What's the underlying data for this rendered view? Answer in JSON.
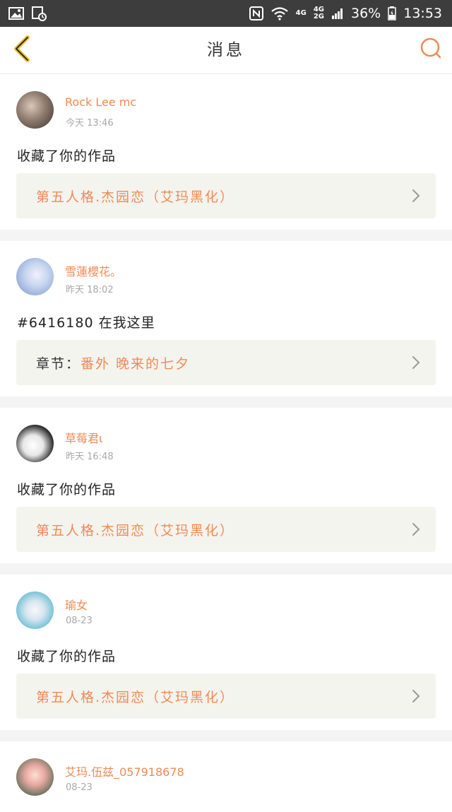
{
  "status_bar": {
    "network": "4G",
    "network2": "4G",
    "network3": "2G",
    "battery": "36%",
    "time": "13:53"
  },
  "header": {
    "title": "消息",
    "back_icon": "chevron-left-icon",
    "search_icon": "search-icon",
    "accent_color": "#f08a55"
  },
  "messages": [
    {
      "username": "Rock Lee mc",
      "time": "今天 13:46",
      "action": "收藏了你的作品",
      "work_prefix": "",
      "work": "第五人格.杰园恋（艾玛黑化）"
    },
    {
      "username": "雪蓮櫻花。",
      "time": "昨天 18:02",
      "action": "#6416180 在我这里",
      "work_prefix": "章节：",
      "work": "番外  晚来的七夕"
    },
    {
      "username": "草莓君ι",
      "time": "昨天 16:48",
      "action": "收藏了你的作品",
      "work_prefix": "",
      "work": "第五人格.杰园恋（艾玛黑化）"
    },
    {
      "username": "瑜女",
      "time": "08-23",
      "action": "收藏了你的作品",
      "work_prefix": "",
      "work": "第五人格.杰园恋（艾玛黑化）"
    },
    {
      "username": "艾玛.伍兹_057918678",
      "time": "08-23"
    }
  ]
}
